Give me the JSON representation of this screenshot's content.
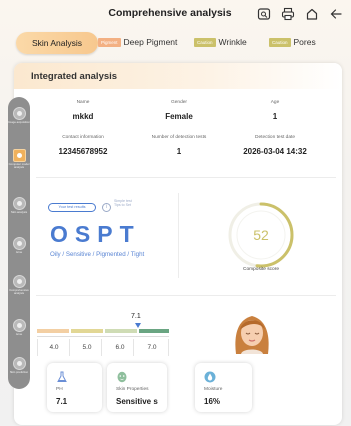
{
  "header": {
    "title": "Comprehensive analysis",
    "icons": [
      "preview-icon",
      "print-icon",
      "home-icon",
      "back-arrow-icon"
    ]
  },
  "tabs": [
    {
      "label": "Skin Analysis",
      "active": true
    },
    {
      "label": "Deep Pigment",
      "badge": "Pigment",
      "badge_color": "#f3b083"
    },
    {
      "label": "Wrinkle",
      "badge": "Caution",
      "badge_color": "#cbc16a"
    },
    {
      "label": "Pores",
      "badge": "Caution",
      "badge_color": "#cbc16a"
    }
  ],
  "section": {
    "title": "Integrated analysis"
  },
  "rail": [
    {
      "label": "Image acquisition"
    },
    {
      "label": "Computer model analysis"
    },
    {
      "label": "Skin analysis"
    },
    {
      "label": "Acne"
    },
    {
      "label": "Comprehensive analysis"
    },
    {
      "label": "Acne"
    },
    {
      "label": "Skin prediction"
    }
  ],
  "profile": {
    "name_label": "Name",
    "name": "mkkd",
    "gender_label": "Gender",
    "gender": "Female",
    "age_label": "Age",
    "age": "1",
    "contact_label": "Contact information",
    "contact": "12345678952",
    "tests_label": "Number of detection tests",
    "tests": "1",
    "date_label": "Detection test date",
    "date": "2026-03-04 14:32"
  },
  "result": {
    "pill": "Your test results",
    "simple": "Simple test Tips to Set",
    "code": "OSPT",
    "description": "Oily / Sensitive / Pigmented / Tight"
  },
  "score": {
    "value": "52",
    "fraction": 0.52,
    "label": "Composite score",
    "color": "#cbc16a"
  },
  "scale": {
    "current": "7.1",
    "ticks": [
      "4.0",
      "5.0",
      "6.0",
      "7.0"
    ],
    "segment_colors": [
      "#f3cfa3",
      "#e2d795",
      "#cfdcb5",
      "#6aa582"
    ]
  },
  "cards": [
    {
      "label": "PH",
      "value": "7.1",
      "icon": "flask-icon"
    },
    {
      "label": "Skin Properties",
      "value": "Sensitive s",
      "icon": "face-mask-icon"
    },
    {
      "label": "Moisture",
      "value": "16%",
      "icon": "water-drop-icon"
    }
  ]
}
